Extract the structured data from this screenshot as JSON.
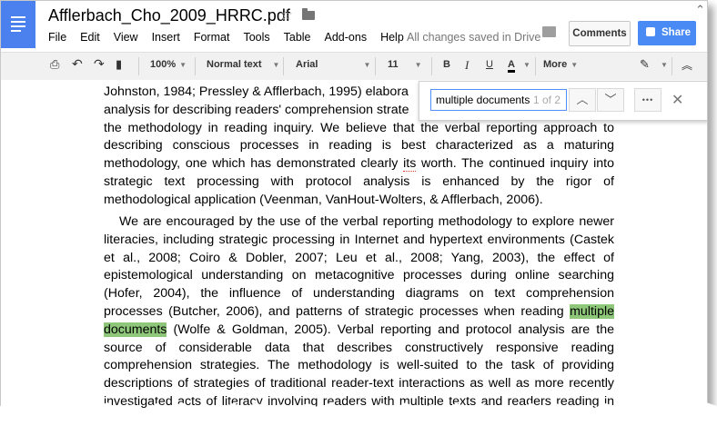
{
  "title": "Afflerbach_Cho_2009_HRRC.pdf",
  "menu": [
    "File",
    "Edit",
    "View",
    "Insert",
    "Format",
    "Tools",
    "Table",
    "Add-ons",
    "Help"
  ],
  "save_status": "All changes saved in Drive",
  "buttons": {
    "comments": "Comments",
    "share": "Share"
  },
  "toolbar": {
    "zoom": "100%",
    "style": "Normal text",
    "font": "Arial",
    "size": "11",
    "bold": "B",
    "italic": "I",
    "underline": "U",
    "text_color": "A",
    "more": "More"
  },
  "find": {
    "query": "multiple documents",
    "count": "1 of 2",
    "more": "•••"
  },
  "paragraph1": [
    "Johnston, 1984; Pressley & Afflerbach, 1995) elabora",
    "analysis for describing readers' comprehension strate",
    "the methodology in reading inquiry. We believe that the verbal reporting approach to",
    "describing conscious processes in reading is best characterized as a maturing",
    "methodology, one which has demonstrated clearly ",
    "its",
    " worth. The continued inquiry into",
    "strategic text processing with protocol analysis is enhanced by the rigor of",
    "methodological application (Veenman, VanHout-Wolters, & Afflerbach, 2006)."
  ],
  "paragraph2": [
    "We are encouraged by the use of the verbal reporting methodology to explore newer",
    "literacies, including strategic processing in Internet and hypertext environments (Castek",
    "et al., 2008; Coiro & Dobler, 2007; Leu et al., 2008; Yang, 2003), the effect of",
    "epistemological understanding on metacognitive processes during online searching",
    "(Hofer, 2004), the influence of understanding diagrams on text comprehension",
    "processes (Butcher, 2006), and patterns of strategic processes when reading ",
    "multiple",
    "documents",
    " (Wolfe & Goldman, 2005). Verbal reporting and protocol analysis are the",
    "source of considerable data that describes constructively responsive reading",
    "comprehension strategies. The methodology is well-suited to the task of providing",
    "descriptions of strategies of traditional reader-text interactions as well as more recently",
    "investigated acts of literacy involving readers with multiple texts and readers reading in"
  ],
  "colors": {
    "brand_blue": "#4b80ef",
    "share_blue": "#4a8af4",
    "highlight": "#8ec77a"
  }
}
